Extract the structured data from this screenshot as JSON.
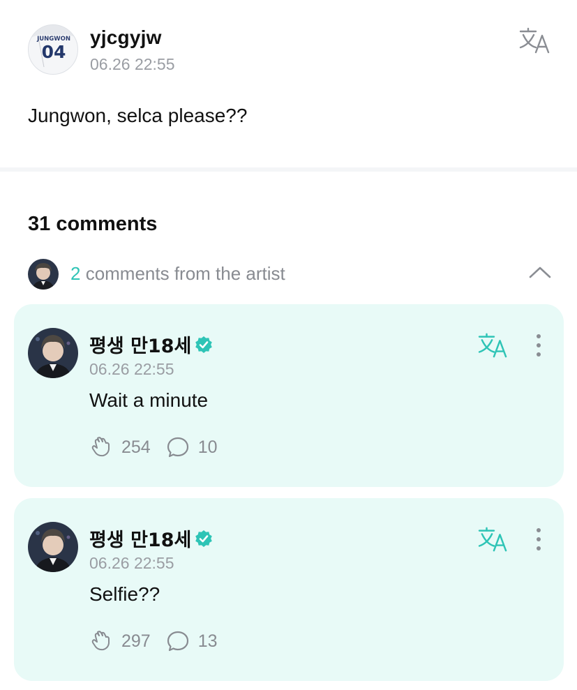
{
  "post": {
    "username": "yjcgyjw",
    "date": "06.26 22:55",
    "body": "Jungwon, selca please??",
    "avatar_jersey_name": "JUNGWON",
    "avatar_jersey_number": "04",
    "translate_icon": "translate-icon"
  },
  "comments": {
    "count_label": "31 comments",
    "artist_count": "2",
    "artist_label": " comments from the artist",
    "collapse_icon": "chevron-up-icon"
  },
  "artist_comments": [
    {
      "name": "평생 만18세",
      "verified_icon": "verified-badge-icon",
      "date": "06.26 22:55",
      "text": "Wait a minute",
      "likes": "254",
      "replies": "10"
    },
    {
      "name": "평생 만18세",
      "verified_icon": "verified-badge-icon",
      "date": "06.26 22:55",
      "text": "Selfie??",
      "likes": "297",
      "replies": "13"
    }
  ],
  "colors": {
    "accent": "#2ec4b6",
    "card_background": "#e8faf7",
    "muted_text": "#9a9da3"
  }
}
